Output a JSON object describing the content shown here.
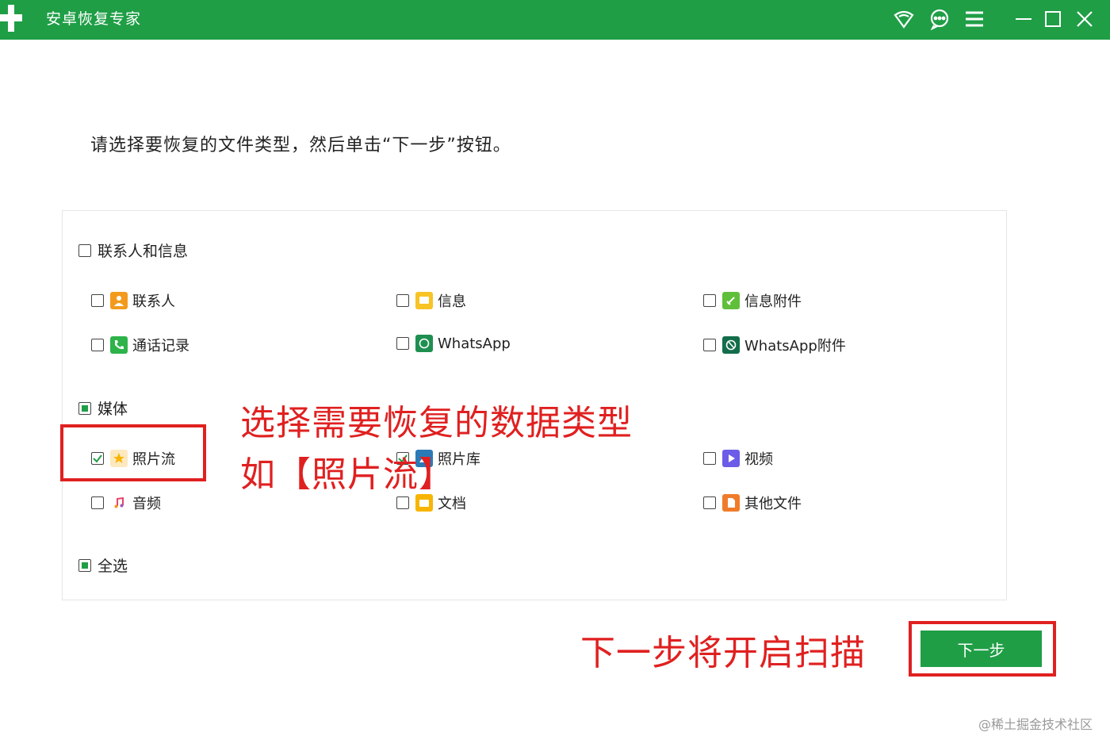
{
  "window": {
    "title": "安卓恢复专家",
    "accent_color": "#1f9e46",
    "controls": [
      "wifi-icon",
      "chat-icon",
      "menu-icon",
      "minimize-icon",
      "maximize-icon",
      "close-icon"
    ]
  },
  "instruction": "请选择要恢复的文件类型，然后单击“下一步”按钮。",
  "groups": {
    "contacts": {
      "label": "联系人和信息",
      "state": "unchecked",
      "items": [
        {
          "label": "联系人",
          "icon": "contact-icon",
          "checked": false
        },
        {
          "label": "信息",
          "icon": "message-icon",
          "checked": false
        },
        {
          "label": "信息附件",
          "icon": "attachment-icon",
          "checked": false
        },
        {
          "label": "通话记录",
          "icon": "phone-icon",
          "checked": false
        },
        {
          "label": "WhatsApp",
          "icon": "whatsapp-icon",
          "checked": false
        },
        {
          "label": "WhatsApp附件",
          "icon": "whatsapp-attachment-icon",
          "checked": false
        }
      ]
    },
    "media": {
      "label": "媒体",
      "state": "partial",
      "items": [
        {
          "label": "照片流",
          "icon": "star-icon",
          "checked": true
        },
        {
          "label": "照片库",
          "icon": "photo-library-icon",
          "checked": true
        },
        {
          "label": "视频",
          "icon": "video-icon",
          "checked": false
        },
        {
          "label": "音频",
          "icon": "audio-icon",
          "checked": false
        },
        {
          "label": "文档",
          "icon": "document-icon",
          "checked": false
        },
        {
          "label": "其他文件",
          "icon": "other-file-icon",
          "checked": false
        }
      ]
    }
  },
  "select_all": {
    "label": "全选",
    "state": "partial"
  },
  "annotations": {
    "line1": "选择需要恢复的数据类型",
    "line2": "如【照片流】",
    "next_hint": "下一步将开启扫描",
    "color": "#e02020"
  },
  "next_button": "下一步",
  "watermark": "@稀土掘金技术社区"
}
